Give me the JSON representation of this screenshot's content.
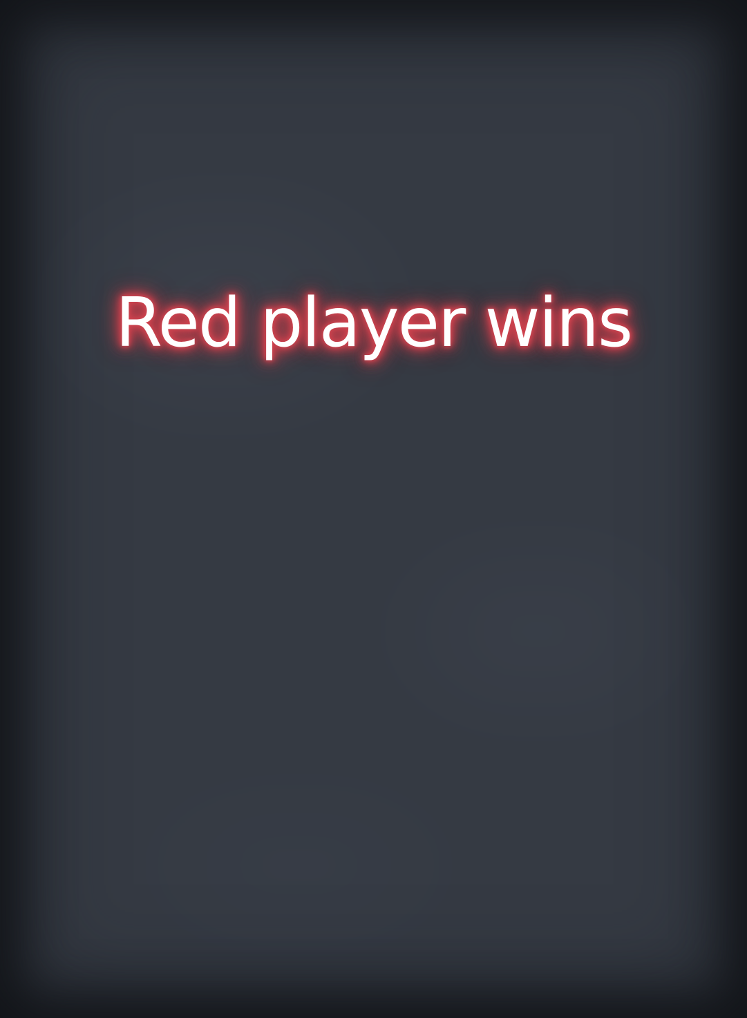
{
  "overlay": {
    "message": "Red player wins",
    "glow_color": "#d0434f",
    "text_color": "#ffffff"
  },
  "theme": {
    "background": "#353a43",
    "edge": "#1c1f24"
  }
}
